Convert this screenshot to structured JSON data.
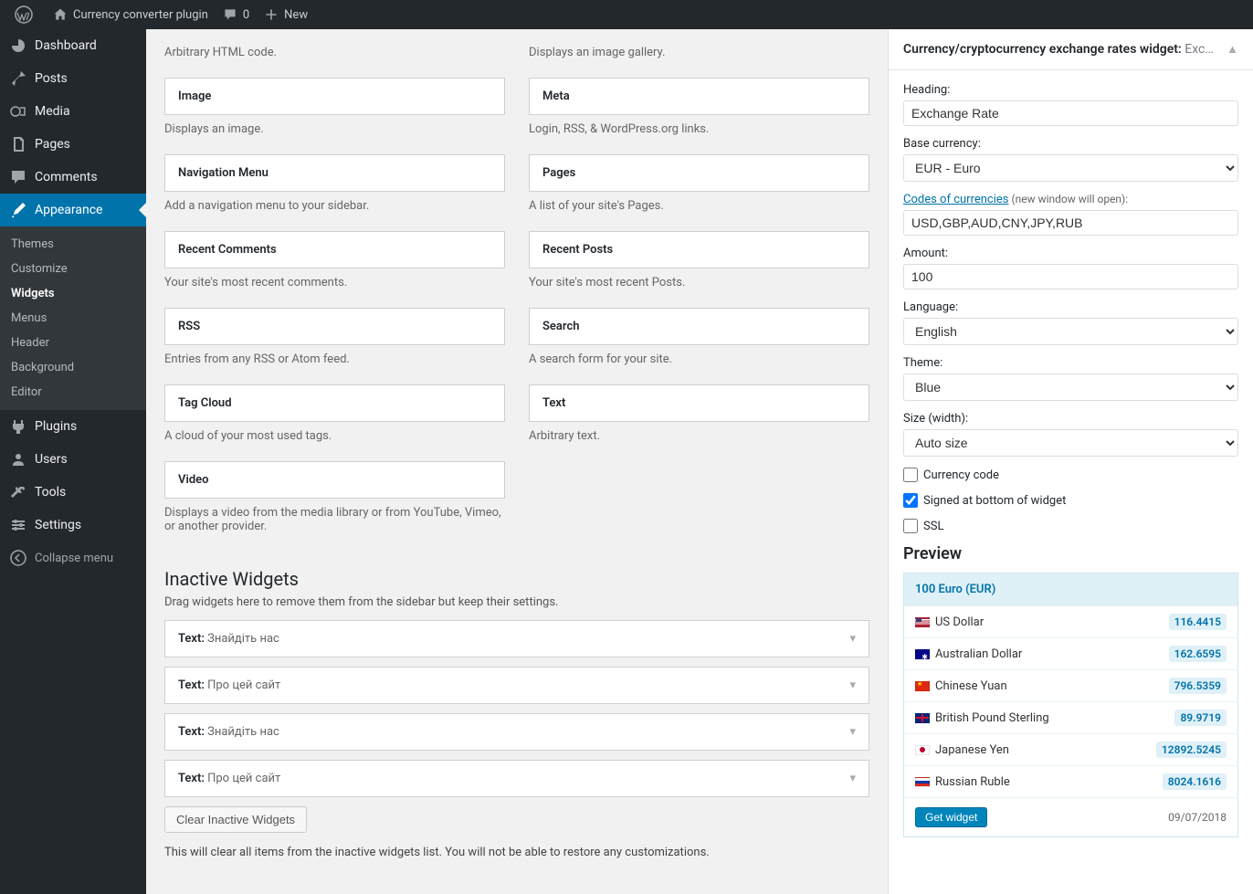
{
  "adminbar": {
    "site_name": "Currency converter plugin",
    "comments_count": "0",
    "new_label": "New"
  },
  "sidebar": {
    "dashboard": "Dashboard",
    "posts": "Posts",
    "media": "Media",
    "pages": "Pages",
    "comments": "Comments",
    "appearance": "Appearance",
    "sub_themes": "Themes",
    "sub_customize": "Customize",
    "sub_widgets": "Widgets",
    "sub_menus": "Menus",
    "sub_header": "Header",
    "sub_background": "Background",
    "sub_editor": "Editor",
    "plugins": "Plugins",
    "users": "Users",
    "tools": "Tools",
    "settings": "Settings",
    "collapse": "Collapse menu"
  },
  "widgets": [
    {
      "title": "",
      "desc": "Arbitrary HTML code."
    },
    {
      "title": "",
      "desc": "Displays an image gallery."
    },
    {
      "title": "Image",
      "desc": "Displays an image."
    },
    {
      "title": "Meta",
      "desc": "Login, RSS, & WordPress.org links."
    },
    {
      "title": "Navigation Menu",
      "desc": "Add a navigation menu to your sidebar."
    },
    {
      "title": "Pages",
      "desc": "A list of your site's Pages."
    },
    {
      "title": "Recent Comments",
      "desc": "Your site's most recent comments."
    },
    {
      "title": "Recent Posts",
      "desc": "Your site's most recent Posts."
    },
    {
      "title": "RSS",
      "desc": "Entries from any RSS or Atom feed."
    },
    {
      "title": "Search",
      "desc": "A search form for your site."
    },
    {
      "title": "Tag Cloud",
      "desc": "A cloud of your most used tags."
    },
    {
      "title": "Text",
      "desc": "Arbitrary text."
    },
    {
      "title": "Video",
      "desc": "Displays a video from the media library or from YouTube, Vimeo, or another provider."
    }
  ],
  "inactive": {
    "heading": "Inactive Widgets",
    "desc": "Drag widgets here to remove them from the sidebar but keep their settings.",
    "items": [
      {
        "type": "Text",
        "title": "Знайдіть нас"
      },
      {
        "type": "Text",
        "title": "Про цей сайт"
      },
      {
        "type": "Text",
        "title": "Знайдіть нас"
      },
      {
        "type": "Text",
        "title": "Про цей сайт"
      }
    ],
    "clear_btn": "Clear Inactive Widgets",
    "clear_note": "This will clear all items from the inactive widgets list. You will not be able to restore any customizations."
  },
  "panel": {
    "header_prefix": "Currency/cryptocurrency exchange rates widget: ",
    "header_suffix": "Exc…",
    "heading_label": "Heading:",
    "heading_value": "Exchange Rate",
    "base_label": "Base currency:",
    "base_value": "EUR - Euro",
    "codes_link": "Codes of currencies",
    "codes_hint": " (new window will open):",
    "codes_value": "USD,GBP,AUD,CNY,JPY,RUB",
    "amount_label": "Amount:",
    "amount_value": "100",
    "lang_label": "Language:",
    "lang_value": "English",
    "theme_label": "Theme:",
    "theme_value": "Blue",
    "size_label": "Size (width):",
    "size_value": "Auto size",
    "cb_code": "Currency code",
    "cb_signed": "Signed at bottom of widget",
    "cb_ssl": "SSL",
    "preview_h": "Preview",
    "preview_header": "100 Euro (EUR)",
    "rows": [
      {
        "name": "US Dollar",
        "flag": "us",
        "rate": "116.4415"
      },
      {
        "name": "Australian Dollar",
        "flag": "au",
        "rate": "162.6595"
      },
      {
        "name": "Chinese Yuan",
        "flag": "cn",
        "rate": "796.5359"
      },
      {
        "name": "British Pound Sterling",
        "flag": "gb",
        "rate": "89.9719"
      },
      {
        "name": "Japanese Yen",
        "flag": "jp",
        "rate": "12892.5245"
      },
      {
        "name": "Russian Ruble",
        "flag": "ru",
        "rate": "8024.1616"
      }
    ],
    "get_widget": "Get widget",
    "date": "09/07/2018"
  }
}
